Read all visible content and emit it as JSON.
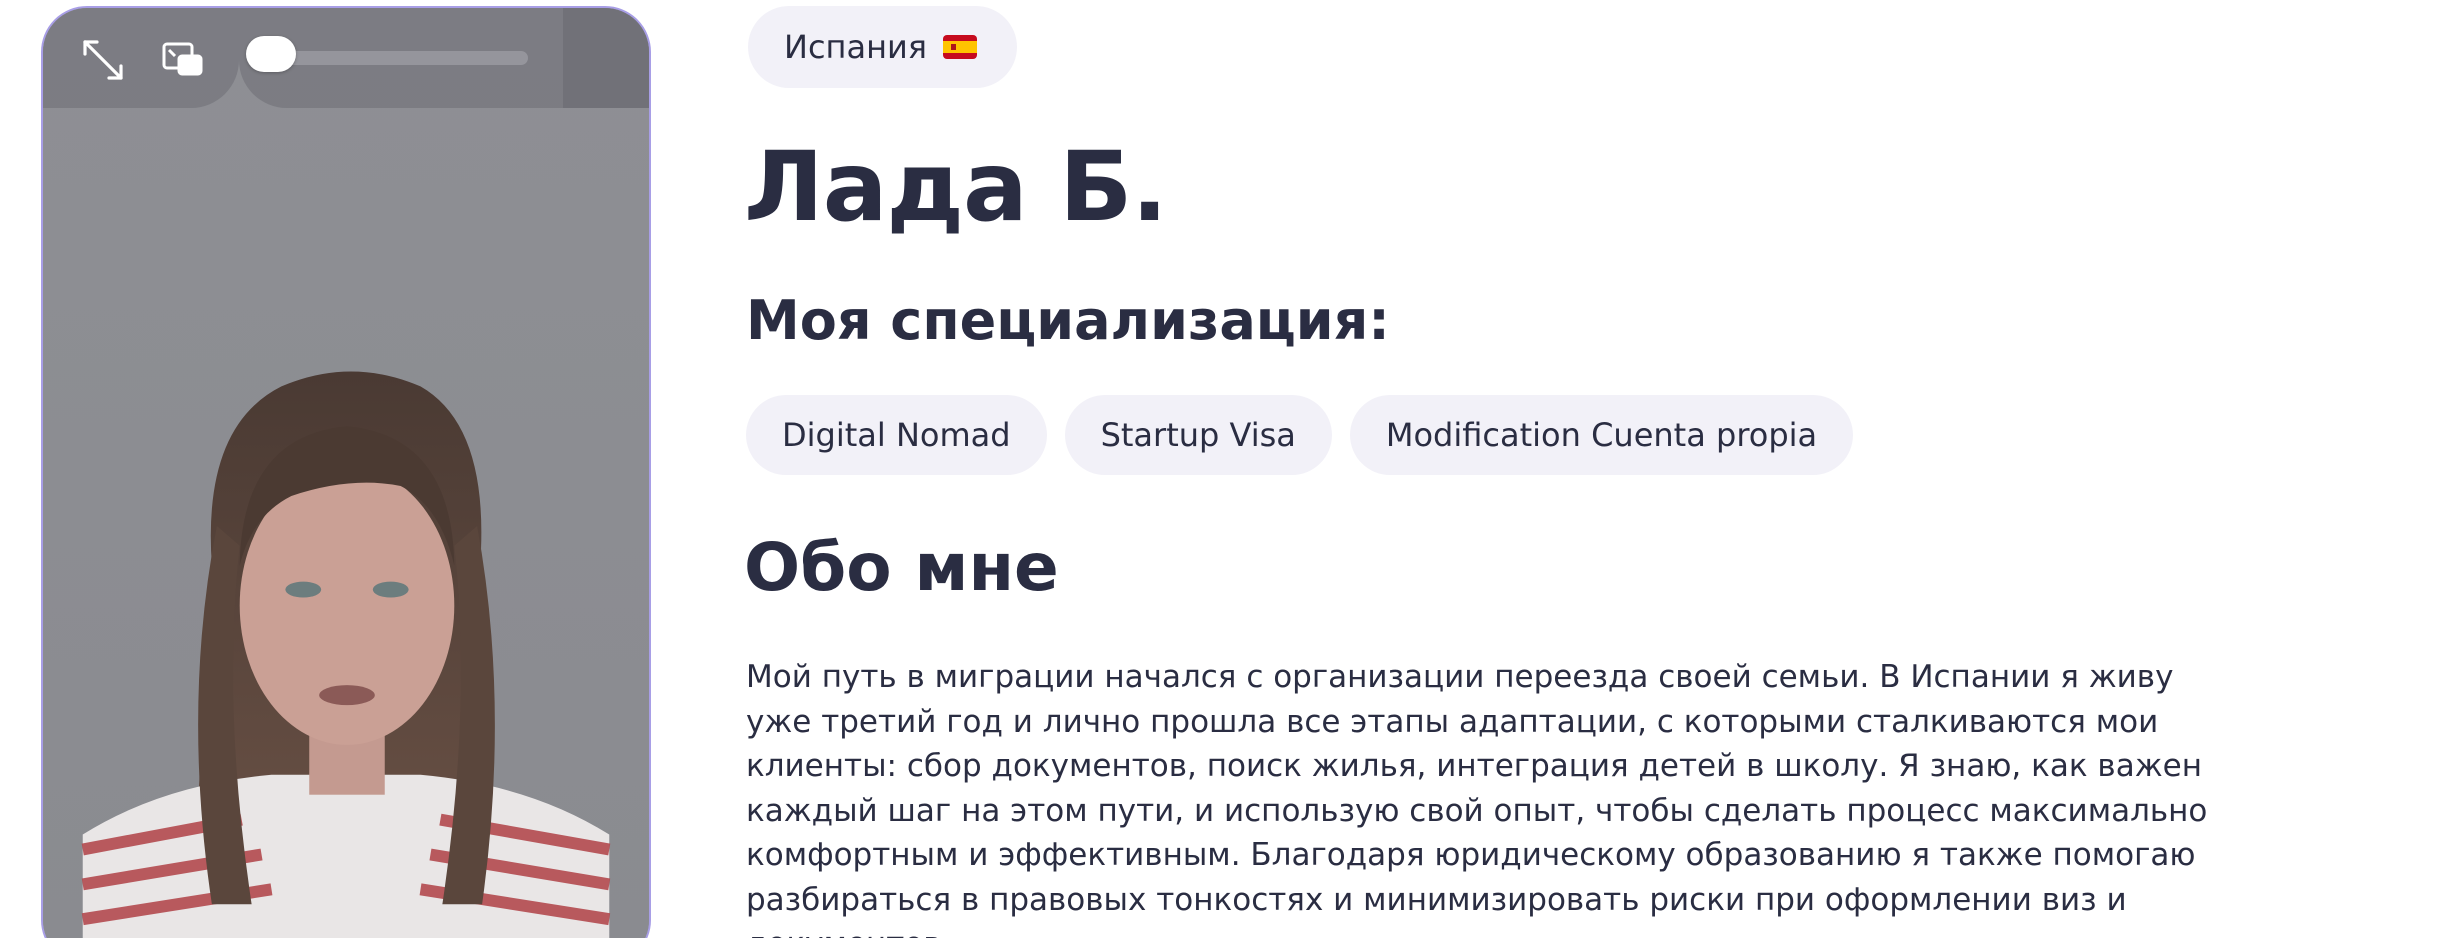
{
  "video": {
    "controls": {
      "expand_icon": "expand-arrows-icon",
      "pip_icon": "picture-in-picture-icon",
      "volume_level": 0.0
    }
  },
  "profile": {
    "country": "Испания",
    "country_flag": "spain-flag",
    "name": "Лада Б.",
    "specialization_title": "Моя специализация:",
    "specializations": [
      "Digital Nomad",
      "Startup Visa",
      "Modification Cuenta propia"
    ],
    "about_title": "Обо мне",
    "about_text": "Мой путь в миграции начался с организации переезда своей семьи. В Испании я живу уже третий год и лично прошла все этапы адаптации, с которыми сталкиваются мои клиенты: сбор документов, поиск жилья, интеграция детей в школу. Я знаю, как важен каждый шаг на этом пути, и использую свой опыт, чтобы сделать процесс максимально комфортным и эффективным. Благодаря юридическому образованию я также помогаю разбираться в правовых тонкостях и минимизировать риски при оформлении виз и документов."
  },
  "colors": {
    "text": "#2a2d42",
    "chip_bg": "#f2f1f8",
    "video_border": "#a89ee6"
  }
}
